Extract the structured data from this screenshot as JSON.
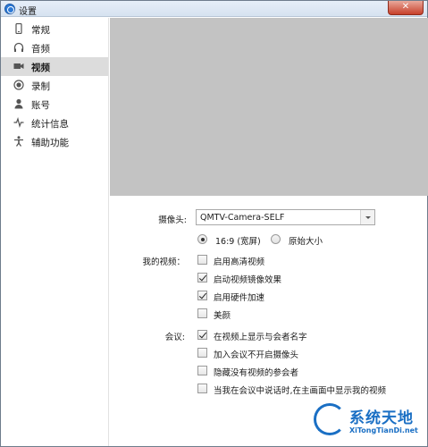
{
  "window": {
    "title": "设置",
    "close_glyph": "✕"
  },
  "sidebar": {
    "items": [
      {
        "label": "常规",
        "icon": "phone-icon"
      },
      {
        "label": "音频",
        "icon": "headphones-icon"
      },
      {
        "label": "视频",
        "icon": "camera-icon",
        "active": true
      },
      {
        "label": "录制",
        "icon": "record-icon"
      },
      {
        "label": "账号",
        "icon": "user-icon"
      },
      {
        "label": "统计信息",
        "icon": "pulse-icon"
      },
      {
        "label": "辅助功能",
        "icon": "accessibility-icon"
      }
    ]
  },
  "video": {
    "camera_label": "摄像头:",
    "camera_value": "QMTV-Camera-SELF",
    "ratio_options": [
      {
        "label": "16:9 (宽屏)",
        "selected": true
      },
      {
        "label": "原始大小",
        "selected": false
      }
    ],
    "my_video_label": "我的视频：",
    "my_video_options": [
      {
        "label": "启用高清视频",
        "checked": false
      },
      {
        "label": "启动视频镜像效果",
        "checked": true
      },
      {
        "label": "启用硬件加速",
        "checked": true
      },
      {
        "label": "美颜",
        "checked": false
      }
    ],
    "meeting_label": "会议:",
    "meeting_options": [
      {
        "label": "在视频上显示与会者名字",
        "checked": true
      },
      {
        "label": "加入会议不开启摄像头",
        "checked": false
      },
      {
        "label": "隐藏没有视频的参会者",
        "checked": false
      },
      {
        "label": "当我在会议中说话时,在主画面中显示我的视频",
        "checked": false
      }
    ]
  },
  "watermark": {
    "main": "系统天地",
    "sub": "XiTongTianDi.net"
  },
  "colors": {
    "active_nav": "#dcdcdc",
    "preview_bg": "#c3c3c3",
    "close_red": "#c7402a",
    "watermark_blue": "#1a6fc4"
  }
}
